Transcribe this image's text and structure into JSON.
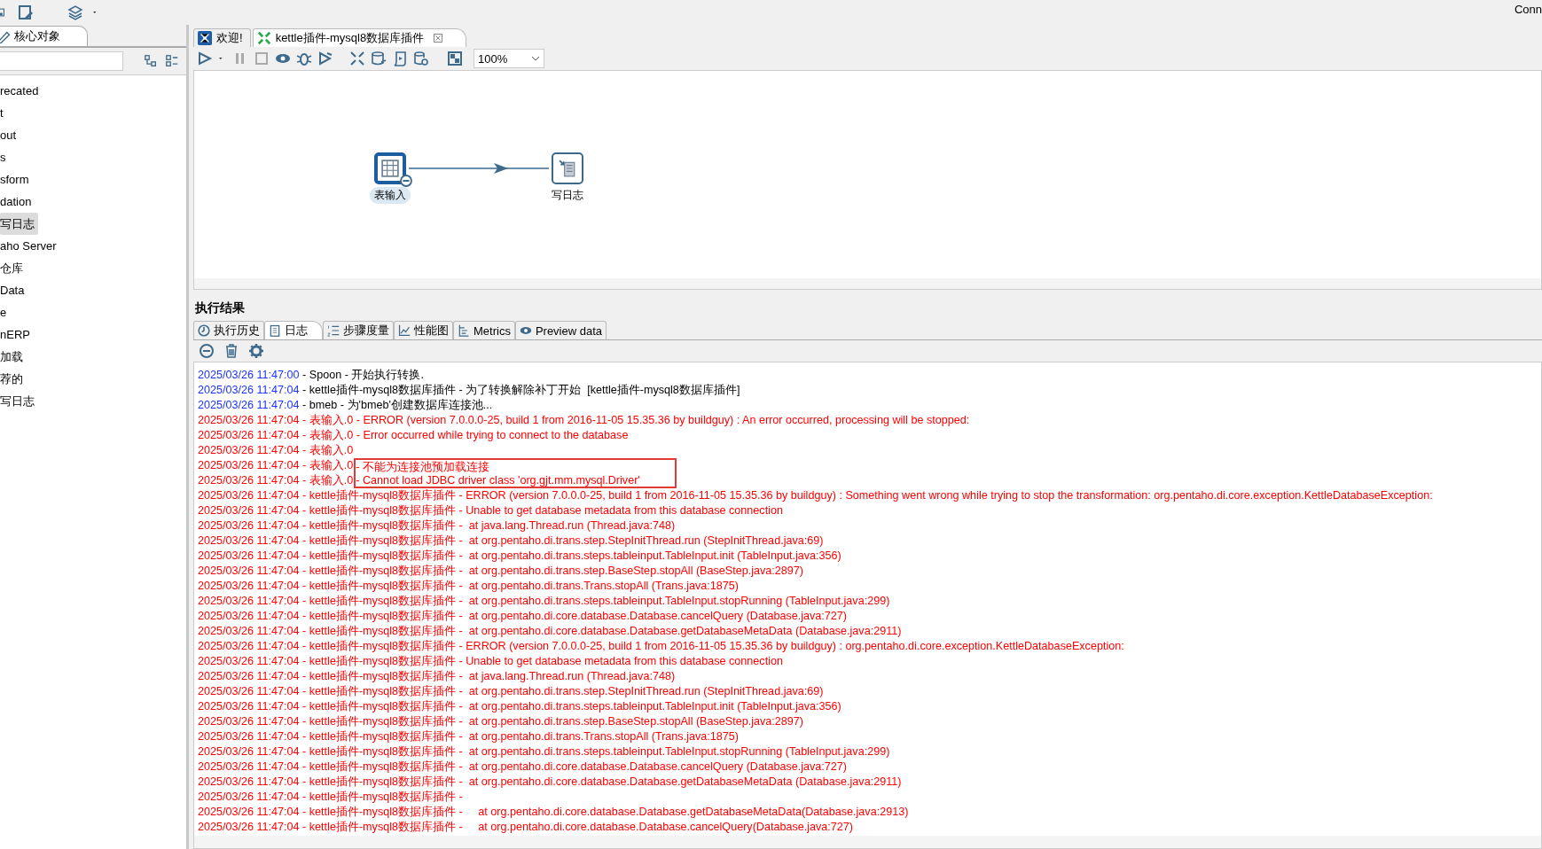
{
  "top_toolbar": {
    "right_text": "Conn"
  },
  "sidebar": {
    "tab": {
      "label": "核心对象",
      "selected": true
    },
    "items": [
      {
        "label": "recated",
        "selected": false
      },
      {
        "label": "t",
        "selected": false
      },
      {
        "label": "out",
        "selected": false
      },
      {
        "label": "s",
        "selected": false
      },
      {
        "label": "sform",
        "selected": false
      },
      {
        "label": "dation",
        "selected": false
      },
      {
        "label": "写日志",
        "selected": true
      },
      {
        "label": "aho Server",
        "selected": false
      },
      {
        "label": "仓库",
        "selected": false
      },
      {
        "label": "Data",
        "selected": false
      },
      {
        "label": "e",
        "selected": false
      },
      {
        "label": "nERP",
        "selected": false
      },
      {
        "label": "加载",
        "selected": false
      },
      {
        "label": "荐的",
        "selected": false
      },
      {
        "label": "写日志",
        "selected": false
      }
    ]
  },
  "editor_tabs": [
    {
      "label": "欢迎!",
      "kind": "welcome",
      "selected": false,
      "closable": false
    },
    {
      "label": "kettle插件-mysql8数据库插件",
      "kind": "transformation",
      "selected": true,
      "closable": true
    }
  ],
  "zoom": {
    "value": "100%"
  },
  "canvas": {
    "steps": [
      {
        "label": "表输入",
        "kind": "table-input",
        "selected": true
      },
      {
        "label": "写日志",
        "kind": "write-log",
        "selected": false
      }
    ]
  },
  "results": {
    "title": "执行结果",
    "tabs": [
      {
        "label": "执行历史",
        "kind": "history",
        "selected": false
      },
      {
        "label": "日志",
        "kind": "log",
        "selected": true
      },
      {
        "label": "步骤度量",
        "kind": "metrics-list",
        "selected": false
      },
      {
        "label": "性能图",
        "kind": "chart",
        "selected": false
      },
      {
        "label": "Metrics",
        "kind": "tree",
        "selected": false
      },
      {
        "label": "Preview data",
        "kind": "preview",
        "selected": false
      }
    ],
    "log": [
      {
        "kind": "info",
        "time": "2025/03/26 11:47:00",
        "text": " - Spoon - 开始执行转换."
      },
      {
        "kind": "info",
        "time": "2025/03/26 11:47:04",
        "text": " - kettle插件-mysql8数据库插件 - 为了转换解除补丁开始  [kettle插件-mysql8数据库插件]"
      },
      {
        "kind": "info",
        "time": "2025/03/26 11:47:04",
        "text": " - bmeb - 为'bmeb'创建数据库连接池..."
      },
      {
        "kind": "error",
        "time": "2025/03/26 11:47:04",
        "text": " - 表输入.0 - ERROR (version 7.0.0.0-25, build 1 from 2016-11-05 15.35.36 by buildguy) : An error occurred, processing will be stopped:"
      },
      {
        "kind": "error",
        "time": "2025/03/26 11:47:04",
        "text": " - 表输入.0 - Error occurred while trying to connect to the database"
      },
      {
        "kind": "error",
        "time": "2025/03/26 11:47:04",
        "text": " - 表输入.0"
      },
      {
        "kind": "error",
        "time": "2025/03/26 11:47:04",
        "text": " - 表输入.0",
        "note": "- 不能为连接池预加载连接"
      },
      {
        "kind": "error",
        "time": "2025/03/26 11:47:04",
        "text": " - 表输入.0",
        "note": "- Cannot load JDBC driver class 'org.gjt.mm.mysql.Driver'"
      },
      {
        "kind": "error",
        "time": "2025/03/26 11:47:04",
        "text": " - kettle插件-mysql8数据库插件 - ERROR (version 7.0.0.0-25, build 1 from 2016-11-05 15.35.36 by buildguy) : Something went wrong while trying to stop the transformation: org.pentaho.di.core.exception.KettleDatabaseException:"
      },
      {
        "kind": "error",
        "time": "2025/03/26 11:47:04",
        "text": " - kettle插件-mysql8数据库插件 - Unable to get database metadata from this database connection"
      },
      {
        "kind": "error",
        "time": "2025/03/26 11:47:04",
        "text": " - kettle插件-mysql8数据库插件 -  at java.lang.Thread.run (Thread.java:748)"
      },
      {
        "kind": "error",
        "time": "2025/03/26 11:47:04",
        "text": " - kettle插件-mysql8数据库插件 -  at org.pentaho.di.trans.step.StepInitThread.run (StepInitThread.java:69)"
      },
      {
        "kind": "error",
        "time": "2025/03/26 11:47:04",
        "text": " - kettle插件-mysql8数据库插件 -  at org.pentaho.di.trans.steps.tableinput.TableInput.init (TableInput.java:356)"
      },
      {
        "kind": "error",
        "time": "2025/03/26 11:47:04",
        "text": " - kettle插件-mysql8数据库插件 -  at org.pentaho.di.trans.step.BaseStep.stopAll (BaseStep.java:2897)"
      },
      {
        "kind": "error",
        "time": "2025/03/26 11:47:04",
        "text": " - kettle插件-mysql8数据库插件 -  at org.pentaho.di.trans.Trans.stopAll (Trans.java:1875)"
      },
      {
        "kind": "error",
        "time": "2025/03/26 11:47:04",
        "text": " - kettle插件-mysql8数据库插件 -  at org.pentaho.di.trans.steps.tableinput.TableInput.stopRunning (TableInput.java:299)"
      },
      {
        "kind": "error",
        "time": "2025/03/26 11:47:04",
        "text": " - kettle插件-mysql8数据库插件 -  at org.pentaho.di.core.database.Database.cancelQuery (Database.java:727)"
      },
      {
        "kind": "error",
        "time": "2025/03/26 11:47:04",
        "text": " - kettle插件-mysql8数据库插件 -  at org.pentaho.di.core.database.Database.getDatabaseMetaData (Database.java:2911)"
      },
      {
        "kind": "error",
        "time": "2025/03/26 11:47:04",
        "text": " - kettle插件-mysql8数据库插件 - ERROR (version 7.0.0.0-25, build 1 from 2016-11-05 15.35.36 by buildguy) : org.pentaho.di.core.exception.KettleDatabaseException:"
      },
      {
        "kind": "error",
        "time": "2025/03/26 11:47:04",
        "text": " - kettle插件-mysql8数据库插件 - Unable to get database metadata from this database connection"
      },
      {
        "kind": "error",
        "time": "2025/03/26 11:47:04",
        "text": " - kettle插件-mysql8数据库插件 -  at java.lang.Thread.run (Thread.java:748)"
      },
      {
        "kind": "error",
        "time": "2025/03/26 11:47:04",
        "text": " - kettle插件-mysql8数据库插件 -  at org.pentaho.di.trans.step.StepInitThread.run (StepInitThread.java:69)"
      },
      {
        "kind": "error",
        "time": "2025/03/26 11:47:04",
        "text": " - kettle插件-mysql8数据库插件 -  at org.pentaho.di.trans.steps.tableinput.TableInput.init (TableInput.java:356)"
      },
      {
        "kind": "error",
        "time": "2025/03/26 11:47:04",
        "text": " - kettle插件-mysql8数据库插件 -  at org.pentaho.di.trans.step.BaseStep.stopAll (BaseStep.java:2897)"
      },
      {
        "kind": "error",
        "time": "2025/03/26 11:47:04",
        "text": " - kettle插件-mysql8数据库插件 -  at org.pentaho.di.trans.Trans.stopAll (Trans.java:1875)"
      },
      {
        "kind": "error",
        "time": "2025/03/26 11:47:04",
        "text": " - kettle插件-mysql8数据库插件 -  at org.pentaho.di.trans.steps.tableinput.TableInput.stopRunning (TableInput.java:299)"
      },
      {
        "kind": "error",
        "time": "2025/03/26 11:47:04",
        "text": " - kettle插件-mysql8数据库插件 -  at org.pentaho.di.core.database.Database.cancelQuery (Database.java:727)"
      },
      {
        "kind": "error",
        "time": "2025/03/26 11:47:04",
        "text": " - kettle插件-mysql8数据库插件 -  at org.pentaho.di.core.database.Database.getDatabaseMetaData (Database.java:2911)"
      },
      {
        "kind": "error",
        "time": "2025/03/26 11:47:04",
        "text": " - kettle插件-mysql8数据库插件 - "
      },
      {
        "kind": "error",
        "time": "2025/03/26 11:47:04",
        "text": " - kettle插件-mysql8数据库插件 -     at org.pentaho.di.core.database.Database.getDatabaseMetaData(Database.java:2913)"
      },
      {
        "kind": "error",
        "time": "2025/03/26 11:47:04",
        "text": " - kettle插件-mysql8数据库插件 -     at org.pentaho.di.core.database.Database.cancelQuery(Database.java:727)"
      }
    ]
  }
}
